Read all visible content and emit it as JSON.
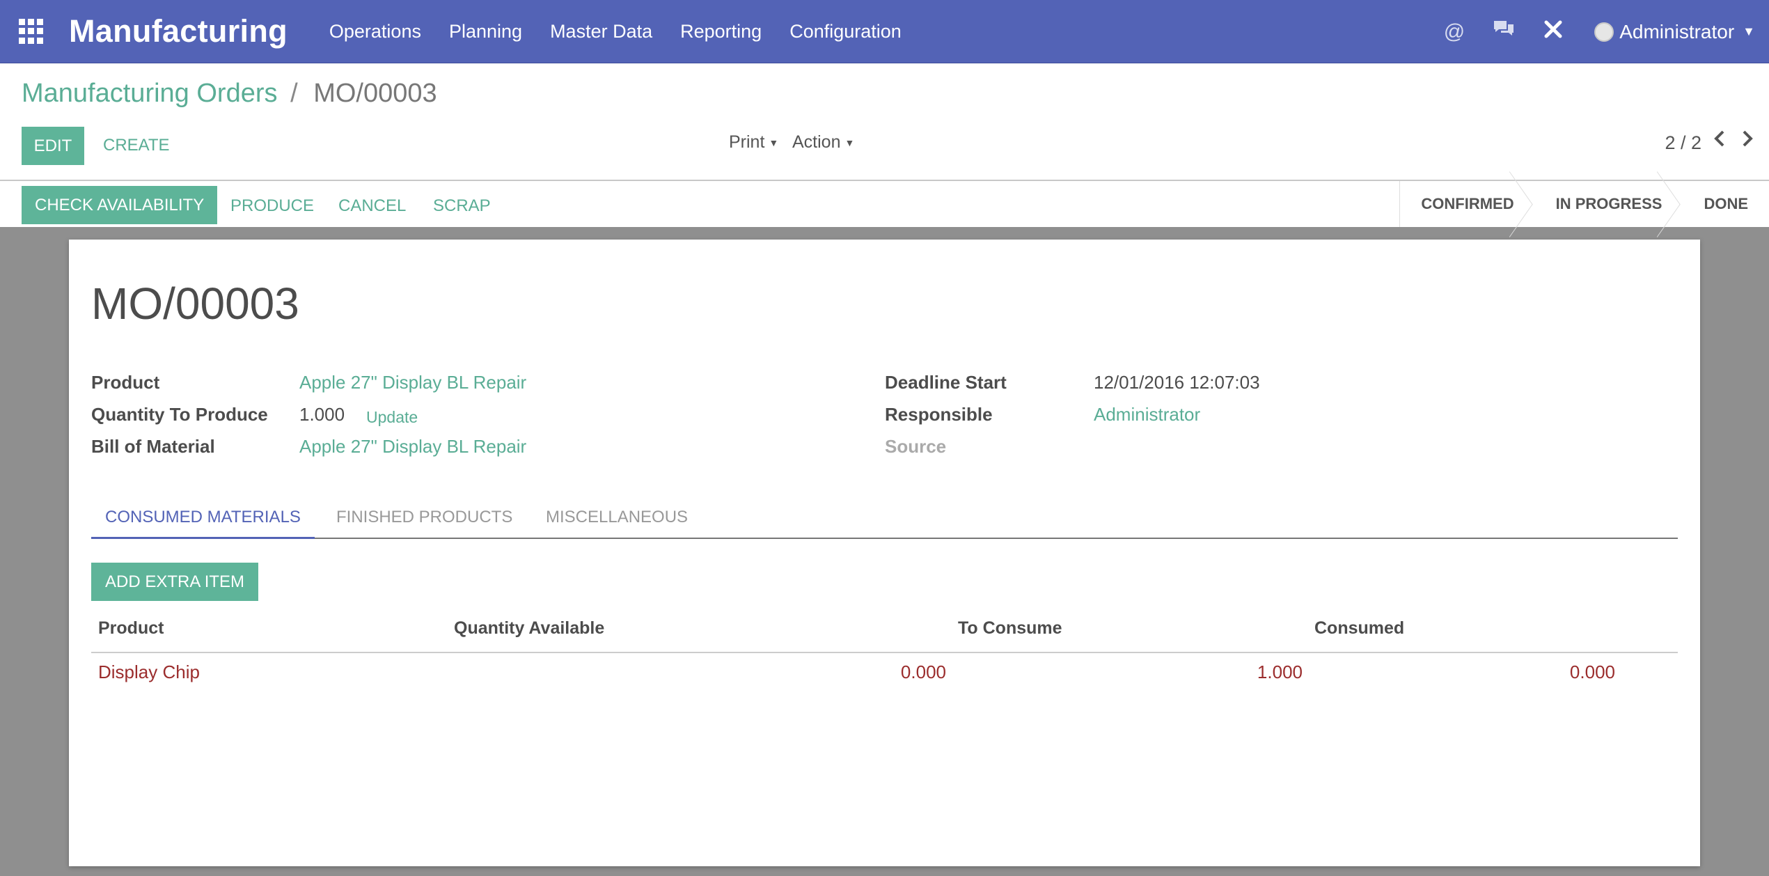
{
  "topnav": {
    "app_title": "Manufacturing",
    "menu": [
      "Operations",
      "Planning",
      "Master Data",
      "Reporting",
      "Configuration"
    ],
    "icons": [
      "at-icon",
      "chat-icon",
      "tools-icon"
    ],
    "user": "Administrator"
  },
  "breadcrumb": {
    "parent": "Manufacturing Orders",
    "separator": "/",
    "current": "MO/00003"
  },
  "toolbar": {
    "edit": "EDIT",
    "create": "CREATE",
    "print": "Print",
    "action": "Action",
    "pager": "2 / 2"
  },
  "statusbar": {
    "check_availability": "CHECK AVAILABILITY",
    "produce": "PRODUCE",
    "cancel": "CANCEL",
    "scrap": "SCRAP",
    "stages": [
      "CONFIRMED",
      "IN PROGRESS",
      "DONE"
    ]
  },
  "form": {
    "title": "MO/00003",
    "product_label": "Product",
    "product_value": "Apple 27\" Display BL Repair",
    "qty_label": "Quantity To Produce",
    "qty_value": "1.000",
    "update_label": "Update",
    "bom_label": "Bill of Material",
    "bom_value": "Apple 27\" Display BL Repair",
    "deadline_label": "Deadline Start",
    "deadline_value": "12/01/2016 12:07:03",
    "responsible_label": "Responsible",
    "responsible_value": "Administrator",
    "source_label": "Source"
  },
  "tabs": [
    "CONSUMED MATERIALS",
    "FINISHED PRODUCTS",
    "MISCELLANEOUS"
  ],
  "materials": {
    "add_button": "ADD EXTRA ITEM",
    "columns": [
      "Product",
      "Quantity Available",
      "To Consume",
      "Consumed"
    ],
    "rows": [
      {
        "product": "Display Chip",
        "available": "0.000",
        "to_consume": "1.000",
        "consumed": "0.000"
      }
    ]
  },
  "colors": {
    "nav": "#5363b6",
    "accent": "#5eb499",
    "row_text": "#9b2d2d"
  }
}
